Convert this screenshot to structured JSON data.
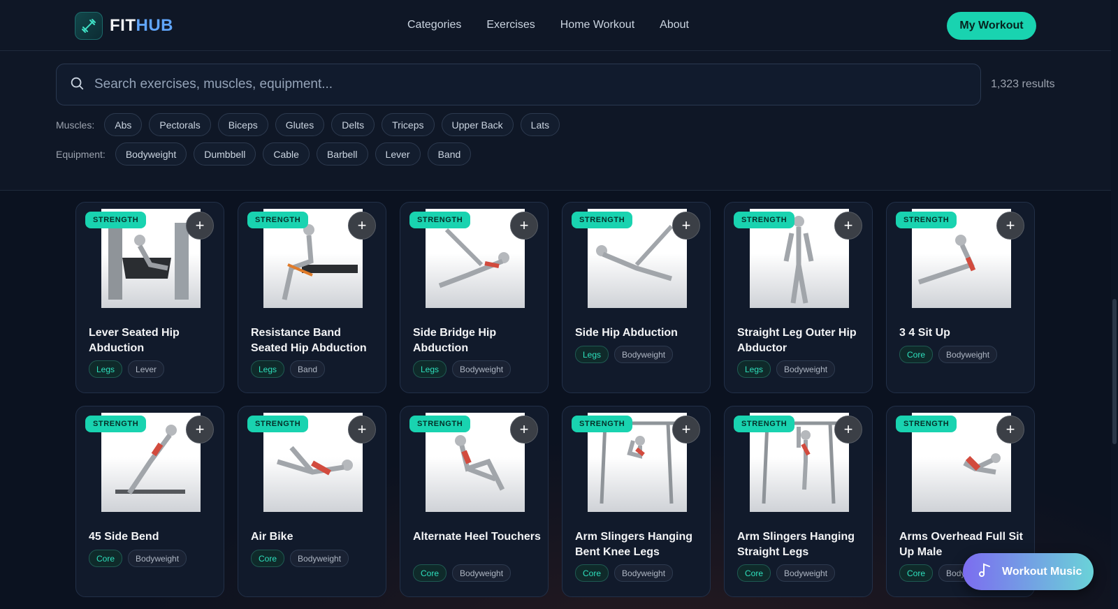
{
  "header": {
    "logo_text_a": "FIT",
    "logo_text_b": "HUB",
    "nav": [
      "Categories",
      "Exercises",
      "Home Workout",
      "About"
    ],
    "cta": "My Workout"
  },
  "search": {
    "placeholder": "Search exercises, muscles, equipment...",
    "results": "1,323 results"
  },
  "filters": {
    "muscles_label": "Muscles:",
    "muscles": [
      "Abs",
      "Pectorals",
      "Biceps",
      "Glutes",
      "Delts",
      "Triceps",
      "Upper Back",
      "Lats"
    ],
    "equipment_label": "Equipment:",
    "equipment": [
      "Bodyweight",
      "Dumbbell",
      "Cable",
      "Barbell",
      "Lever",
      "Band"
    ]
  },
  "cards": [
    {
      "badge": "STRENGTH",
      "title": "Lever Seated Hip Abduction",
      "category": "Legs",
      "equipment": "Lever"
    },
    {
      "badge": "STRENGTH",
      "title": "Resistance Band Seated Hip Abduction",
      "category": "Legs",
      "equipment": "Band"
    },
    {
      "badge": "STRENGTH",
      "title": "Side Bridge Hip Abduction",
      "category": "Legs",
      "equipment": "Bodyweight"
    },
    {
      "badge": "STRENGTH",
      "title": "Side Hip Abduction",
      "category": "Legs",
      "equipment": "Bodyweight"
    },
    {
      "badge": "STRENGTH",
      "title": "Straight Leg Outer Hip Abductor",
      "category": "Legs",
      "equipment": "Bodyweight"
    },
    {
      "badge": "STRENGTH",
      "title": "3 4 Sit Up",
      "category": "Core",
      "equipment": "Bodyweight"
    },
    {
      "badge": "STRENGTH",
      "title": "45 Side Bend",
      "category": "Core",
      "equipment": "Bodyweight"
    },
    {
      "badge": "STRENGTH",
      "title": "Air Bike",
      "category": "Core",
      "equipment": "Bodyweight"
    },
    {
      "badge": "STRENGTH",
      "title": "Alternate Heel Touchers",
      "category": "Core",
      "equipment": "Bodyweight"
    },
    {
      "badge": "STRENGTH",
      "title": "Arm Slingers Hanging Bent Knee Legs",
      "category": "Core",
      "equipment": "Bodyweight"
    },
    {
      "badge": "STRENGTH",
      "title": "Arm Slingers Hanging Straight Legs",
      "category": "Core",
      "equipment": "Bodyweight"
    },
    {
      "badge": "STRENGTH",
      "title": "Arms Overhead Full Sit Up Male",
      "category": "Core",
      "equipment": "Bodyweight"
    }
  ],
  "add_symbol": "+",
  "music": {
    "label": "Workout Music"
  },
  "icons": {
    "logo": "dumbbell-icon",
    "search": "search-icon",
    "add": "plus-icon",
    "music": "music-note-icon"
  },
  "colors": {
    "accent": "#19d3b0",
    "background": "#0b1220"
  }
}
